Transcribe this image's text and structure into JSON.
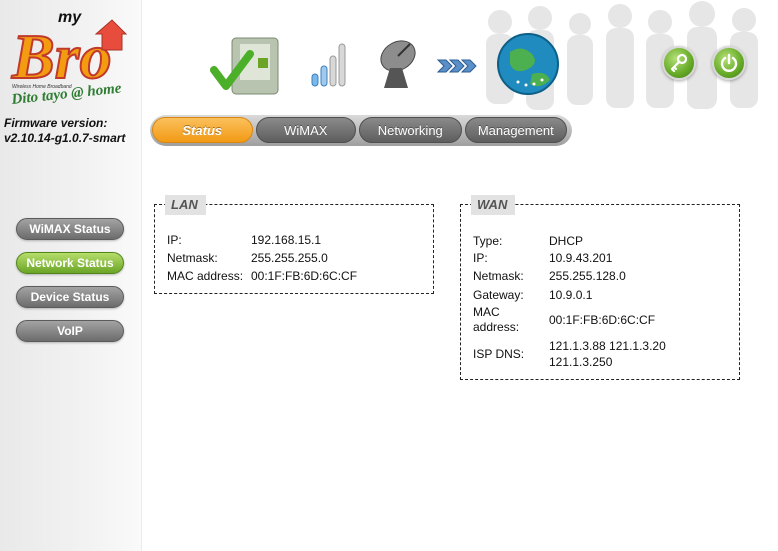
{
  "brand": {
    "logo_small": "my",
    "logo_big": "Bro",
    "logo_subtitle": "Wireless Home Broadband",
    "tagline": "Dito tayo @ home",
    "firmware_label": "Firmware version:",
    "firmware_value": "v2.10.14-g1.0.7-smart"
  },
  "nav": {
    "tabs": [
      {
        "label": "Status",
        "active": true
      },
      {
        "label": "WiMAX",
        "active": false
      },
      {
        "label": "Networking",
        "active": false
      },
      {
        "label": "Management",
        "active": false
      }
    ]
  },
  "sidebar": {
    "items": [
      {
        "label": "WiMAX Status",
        "active": false
      },
      {
        "label": "Network Status",
        "active": true
      },
      {
        "label": "Device Status",
        "active": false
      },
      {
        "label": "VoIP",
        "active": false
      }
    ]
  },
  "lan": {
    "title": "LAN",
    "ip_label": "IP:",
    "ip": "192.168.15.1",
    "netmask_label": "Netmask:",
    "netmask": "255.255.255.0",
    "mac_label": "MAC address:",
    "mac": "00:1F:FB:6D:6C:CF"
  },
  "wan": {
    "title": "WAN",
    "type_label": "Type:",
    "type": "DHCP",
    "ip_label": "IP:",
    "ip": "10.9.43.201",
    "netmask_label": "Netmask:",
    "netmask": "255.255.128.0",
    "gateway_label": "Gateway:",
    "gateway": "10.9.0.1",
    "mac_label_1": "MAC",
    "mac_label_2": "address:",
    "mac": "00:1F:FB:6D:6C:CF",
    "dns_label": "ISP DNS:",
    "dns_line1": "121.1.3.88 121.1.3.20",
    "dns_line2": "121.1.3.250"
  },
  "icons": {
    "device": "device-check-icon",
    "signal": "signal-strength-icon",
    "dish": "satellite-dish-icon",
    "arrows": "connection-arrows-icon",
    "globe": "internet-globe-icon",
    "key": "key-icon",
    "power": "power-icon"
  },
  "colors": {
    "active_tab": "#f29a14",
    "active_side": "#6aa526",
    "inactive": "#6c6c6c"
  }
}
